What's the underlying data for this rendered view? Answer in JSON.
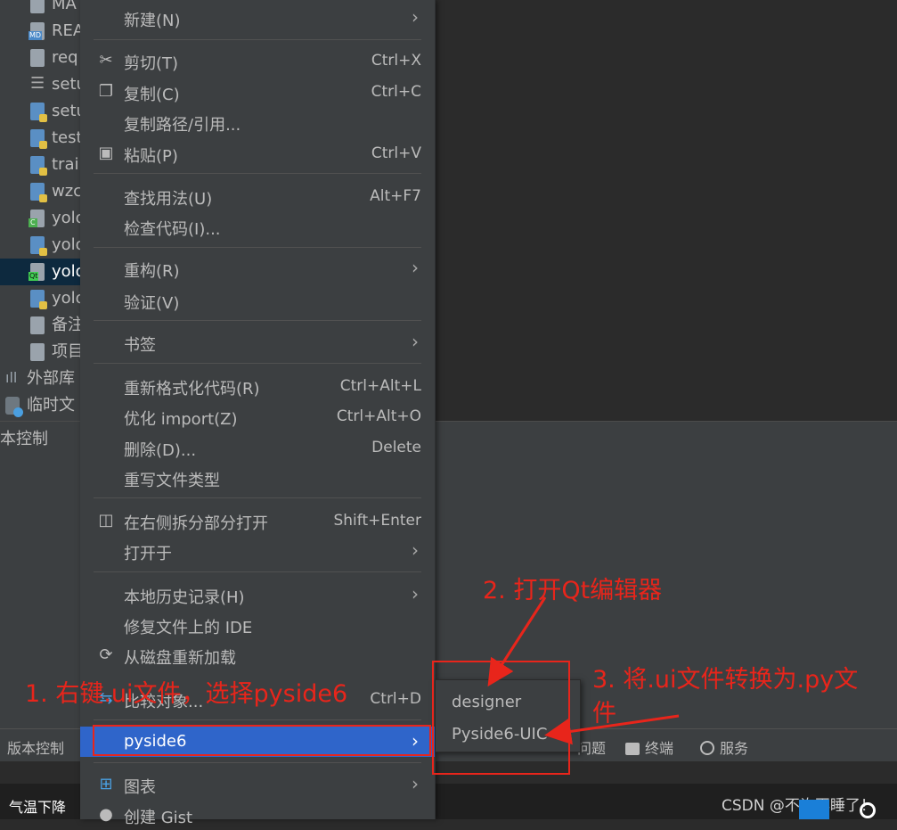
{
  "project_tree": [
    {
      "label": "MA",
      "icon": "file-icon",
      "kind": "doc"
    },
    {
      "label": "REA",
      "icon": "markdown-file-icon",
      "kind": "md"
    },
    {
      "label": "req",
      "icon": "file-icon",
      "kind": "doc"
    },
    {
      "label": "setu",
      "icon": "config-file-icon",
      "kind": "setup"
    },
    {
      "label": "setu",
      "icon": "python-file-icon",
      "kind": "py"
    },
    {
      "label": "test",
      "icon": "python-file-icon",
      "kind": "py"
    },
    {
      "label": "trai",
      "icon": "python-file-icon",
      "kind": "py"
    },
    {
      "label": "wzc",
      "icon": "python-file-icon",
      "kind": "py"
    },
    {
      "label": "yolo",
      "icon": "c-file-icon",
      "kind": "c"
    },
    {
      "label": "yolo",
      "icon": "python-file-icon",
      "kind": "py"
    },
    {
      "label": "yolo",
      "icon": "qt-ui-file-icon",
      "kind": "qt"
    },
    {
      "label": "yolo",
      "icon": "python-file-icon",
      "kind": "py"
    },
    {
      "label": "备注",
      "icon": "file-icon",
      "kind": "doc"
    },
    {
      "label": "项目",
      "icon": "file-icon",
      "kind": "doc"
    },
    {
      "label": "外部库",
      "icon": "library-icon",
      "kind": "lib"
    },
    {
      "label": "临时文",
      "icon": "scratch-icon",
      "kind": "tmp"
    }
  ],
  "bottom_panel": {
    "title": "本控制"
  },
  "context_menu": {
    "new": {
      "label": "新建(N)"
    },
    "cut": {
      "label": "剪切(T)",
      "shortcut": "Ctrl+X"
    },
    "copy": {
      "label": "复制(C)",
      "shortcut": "Ctrl+C"
    },
    "copy_path": {
      "label": "复制路径/引用..."
    },
    "paste": {
      "label": "粘贴(P)",
      "shortcut": "Ctrl+V"
    },
    "find_usages": {
      "label": "查找用法(U)",
      "shortcut": "Alt+F7"
    },
    "inspect": {
      "label": "检查代码(I)..."
    },
    "refactor": {
      "label": "重构(R)"
    },
    "validate": {
      "label": "验证(V)"
    },
    "bookmarks": {
      "label": "书签"
    },
    "reformat": {
      "label": "重新格式化代码(R)",
      "shortcut": "Ctrl+Alt+L"
    },
    "optimize": {
      "label": "优化 import(Z)",
      "shortcut": "Ctrl+Alt+O"
    },
    "delete": {
      "label": "删除(D)...",
      "shortcut": "Delete"
    },
    "override_type": {
      "label": "重写文件类型"
    },
    "split_open": {
      "label": "在右侧拆分部分打开",
      "shortcut": "Shift+Enter"
    },
    "open_in": {
      "label": "打开于"
    },
    "local_history": {
      "label": "本地历史记录(H)"
    },
    "repair_ide": {
      "label": "修复文件上的 IDE"
    },
    "reload": {
      "label": "从磁盘重新加载"
    },
    "compare": {
      "label": "比较对象...",
      "shortcut": "Ctrl+D"
    },
    "pyside6": {
      "label": "pyside6"
    },
    "diagrams": {
      "label": "图表"
    },
    "gist": {
      "label": "创建 Gist"
    }
  },
  "submenu": {
    "designer": "designer",
    "uic": "Pyside6-UIC"
  },
  "tool_windows": {
    "vcs": "版本控制",
    "problems": "问题",
    "terminal": "终端",
    "services": "服务"
  },
  "taskbar": {
    "weather": "气温下降",
    "watermark": "CSDN @不许再睡了！"
  },
  "annotations": {
    "step1": "1. 右键.ui文件，选择pyside6",
    "step2": "2. 打开Qt编辑器",
    "step3_line1": "3. 将.ui文件转换为.py文",
    "step3_line2": "件"
  },
  "colors": {
    "accent": "#2f65ca",
    "annotation_red": "#e8251b",
    "menu_bg": "#3c3f41"
  }
}
